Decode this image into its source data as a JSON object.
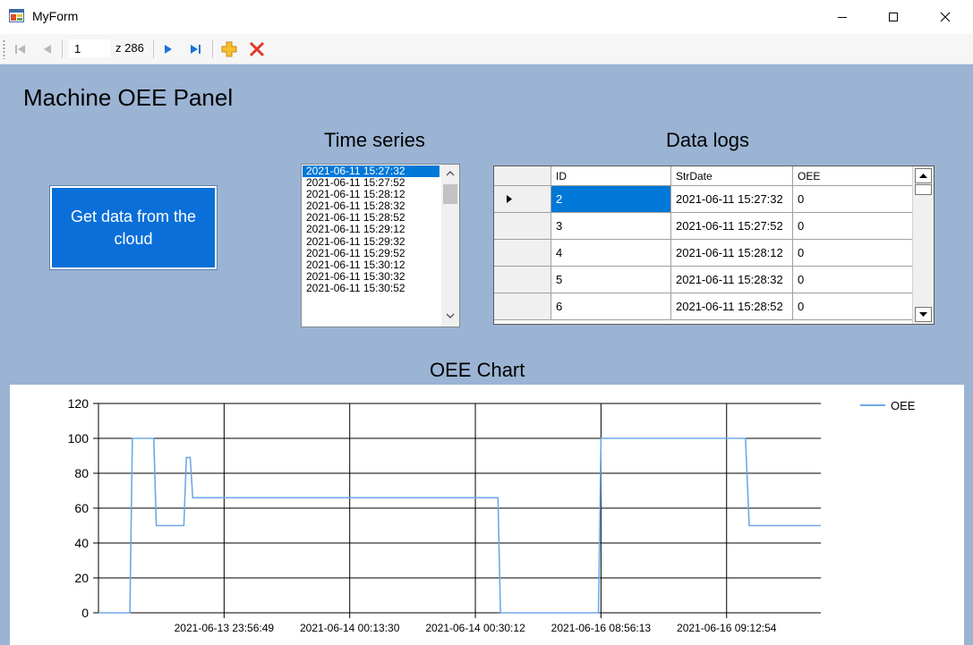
{
  "window": {
    "title": "MyForm"
  },
  "toolbar": {
    "position": "1",
    "count_label": "z 286"
  },
  "panel": {
    "title": "Machine OEE Panel",
    "get_data_button": "Get data from the cloud",
    "time_series_title": "Time series",
    "data_logs_title": "Data logs",
    "chart_title": "OEE Chart"
  },
  "time_series": {
    "selected_index": 0,
    "items": [
      "2021-06-11 15:27:32",
      "2021-06-11 15:27:52",
      "2021-06-11 15:28:12",
      "2021-06-11 15:28:32",
      "2021-06-11 15:28:52",
      "2021-06-11 15:29:12",
      "2021-06-11 15:29:32",
      "2021-06-11 15:29:52",
      "2021-06-11 15:30:12",
      "2021-06-11 15:30:32",
      "2021-06-11 15:30:52"
    ]
  },
  "data_logs": {
    "columns": [
      "ID",
      "StrDate",
      "OEE"
    ],
    "rows": [
      [
        "2",
        "2021-06-11 15:27:32",
        "0"
      ],
      [
        "3",
        "2021-06-11 15:27:52",
        "0"
      ],
      [
        "4",
        "2021-06-11 15:28:12",
        "0"
      ],
      [
        "5",
        "2021-06-11 15:28:32",
        "0"
      ],
      [
        "6",
        "2021-06-11 15:28:52",
        "0"
      ]
    ],
    "current_row": 0
  },
  "colors": {
    "client_background": "#9bb4d4",
    "button_blue": "#0a6fd8",
    "selection_blue": "#0078d7",
    "series_line": "#6fa8e8"
  },
  "chart_data": {
    "type": "line",
    "title": "OEE Chart",
    "xlabel": "",
    "ylabel": "",
    "ylim": [
      0,
      120
    ],
    "yticks": [
      0,
      20,
      40,
      60,
      80,
      100,
      120
    ],
    "x_range": [
      0,
      5.75
    ],
    "x_tick_positions": [
      1,
      2,
      3,
      4,
      5
    ],
    "x_tick_labels": [
      "2021-06-13 23:56:49",
      "2021-06-14 00:13:30",
      "2021-06-14 00:30:12",
      "2021-06-16 08:56:13",
      "2021-06-16 09:12:54"
    ],
    "grid": true,
    "legend": "top-right",
    "series": [
      {
        "name": "OEE",
        "x": [
          0,
          0.25,
          0.27,
          0.44,
          0.46,
          0.68,
          0.7,
          0.73,
          0.75,
          3.18,
          3.2,
          3.98,
          4.0,
          5.15,
          5.18,
          5.75
        ],
        "values": [
          0,
          0,
          100,
          100,
          50,
          50,
          89,
          89,
          66,
          66,
          0,
          0,
          100,
          100,
          50,
          50
        ]
      }
    ]
  }
}
